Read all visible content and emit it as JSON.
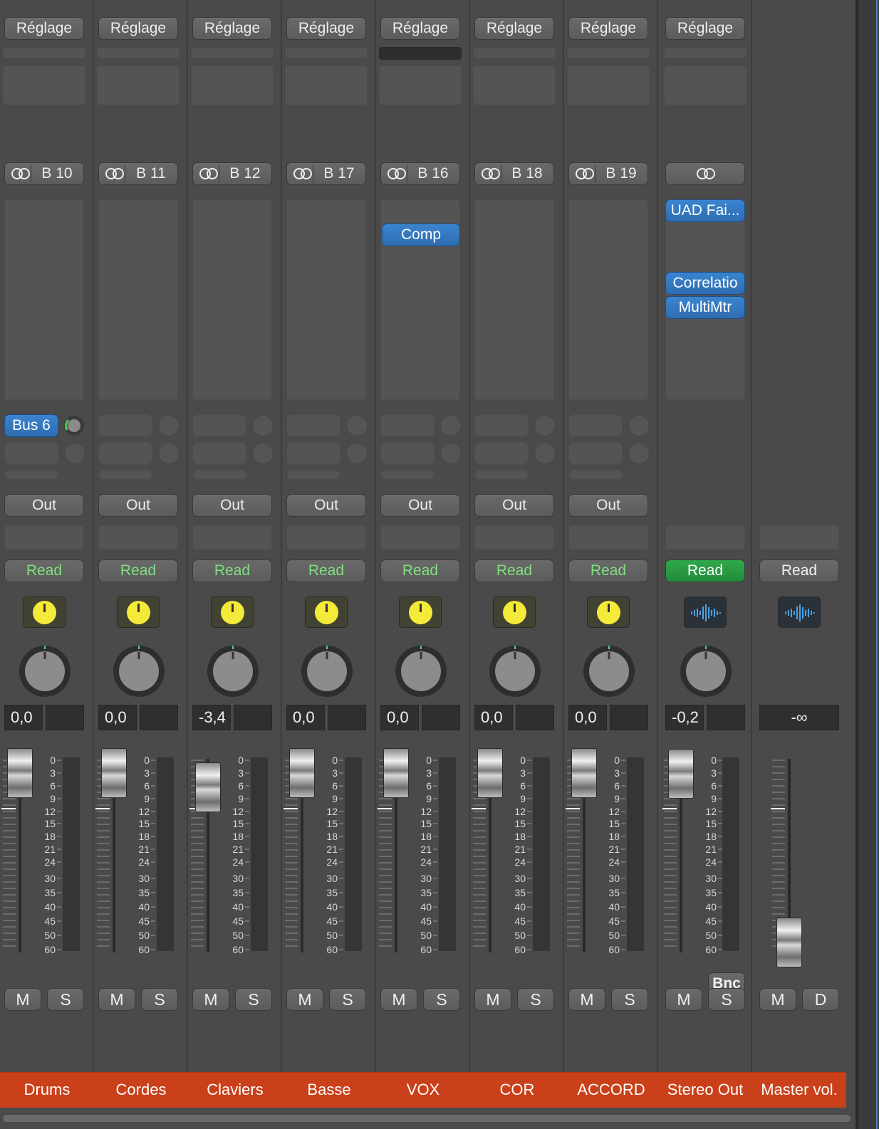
{
  "strips": [
    {
      "name": "Drums",
      "setting": "Réglage",
      "link_label": "B 10",
      "inserts": [],
      "send": "Bus 6",
      "output": "Out",
      "automation": "Read",
      "pan_value": "0,0",
      "fader_db": -3.0
    },
    {
      "name": "Cordes",
      "setting": "Réglage",
      "link_label": "B 11",
      "inserts": [],
      "send": "",
      "output": "Out",
      "automation": "Read",
      "pan_value": "0,0",
      "fader_db": -3.0
    },
    {
      "name": "Claviers",
      "setting": "Réglage",
      "link_label": "B 12",
      "inserts": [],
      "send": "",
      "output": "Out",
      "automation": "Read",
      "pan_value": "-3,4",
      "fader_db": -6.4
    },
    {
      "name": "Basse",
      "setting": "Réglage",
      "link_label": "B 17",
      "inserts": [],
      "send": "",
      "output": "Out",
      "automation": "Read",
      "pan_value": "0,0",
      "fader_db": -3.0
    },
    {
      "name": "VOX",
      "setting": "Réglage",
      "link_label": "B 16",
      "inserts": [
        "Comp"
      ],
      "send": "",
      "output": "Out",
      "automation": "Read",
      "pan_value": "0,0",
      "fader_db": -3.0
    },
    {
      "name": "COR",
      "setting": "Réglage",
      "link_label": "B 18",
      "inserts": [],
      "send": "",
      "output": "Out",
      "automation": "Read",
      "pan_value": "0,0",
      "fader_db": -3.0
    },
    {
      "name": "ACCORD",
      "setting": "Réglage",
      "link_label": "B 19",
      "inserts": [],
      "send": "",
      "output": "Out",
      "automation": "Read",
      "pan_value": "0,0",
      "fader_db": -3.0
    },
    {
      "name": "Stereo Out",
      "setting": "Réglage",
      "link_label": "",
      "inserts": [
        "UAD Fai...",
        "Correlatio",
        "MultiMtr"
      ],
      "send": "",
      "output": "",
      "automation": "Read",
      "pan_value": "-0,2",
      "fader_db": -3.2,
      "bounce": "Bnc"
    },
    {
      "name": "Master vol.",
      "setting": "",
      "link_label": "",
      "inserts": [],
      "send": "",
      "output": "",
      "automation": "Read",
      "pan_value": "-∞",
      "fader_db": -55
    }
  ],
  "mute_label": "M",
  "solo_label": "S",
  "dim_label": "D",
  "scale_labels": [
    "0",
    "3",
    "6",
    "9",
    "12",
    "15",
    "18",
    "21",
    "24",
    "30",
    "35",
    "40",
    "45",
    "50",
    "60"
  ],
  "colors": {
    "name_bar": "#c9401a",
    "read_green_text": "#7fe07f",
    "read_green_fill": "#2fa94a",
    "plugin_blue": "#3a84d0",
    "background": "#4a4a4a"
  },
  "icons": {
    "link": "link-rings-icon",
    "input_mono": "yellow-dot-icon",
    "input_stereo": "waveform-icon",
    "pan": "pan-knob-icon"
  }
}
